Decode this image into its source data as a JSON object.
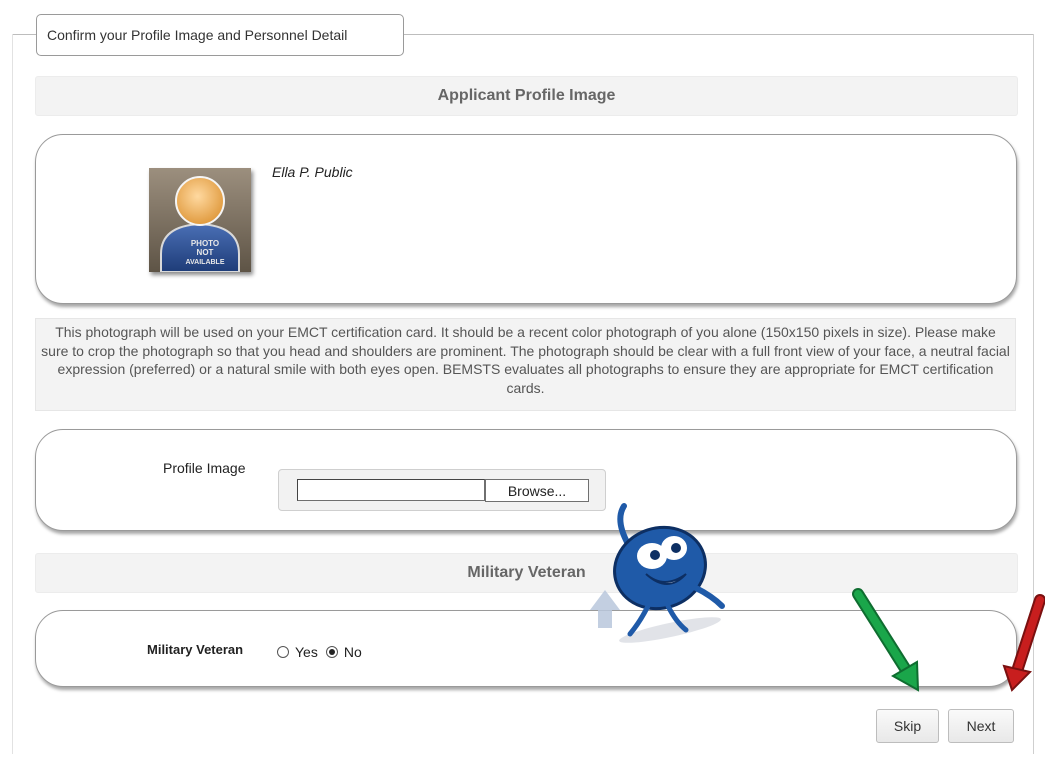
{
  "legend": "Confirm your Profile Image and Personnel Detail",
  "profile_section": {
    "title": "Applicant Profile Image",
    "name": "Ella P. Public",
    "avatar_text": [
      "PHOTO",
      "NOT",
      "AVAILABLE"
    ]
  },
  "note": "This photograph will be used on your EMCT certification card. It should be a recent color photograph of you alone (150x150 pixels in size). Please make sure to crop the photograph so that you head and shoulders are prominent. The photograph should be clear with a full front view of your face, a neutral facial expression (preferred) or a natural smile with both eyes open. BEMSTS evaluates all photographs to ensure they are appropriate for EMCT certification cards.",
  "upload": {
    "label": "Profile Image",
    "value": "",
    "browse_label": "Browse..."
  },
  "military_section": {
    "title": "Military Veteran",
    "label": "Military Veteran",
    "options": [
      "Yes",
      "No"
    ],
    "selected": "No"
  },
  "buttons": {
    "skip": "Skip",
    "next": "Next"
  },
  "colors": {
    "green_arrow": "#1aa64a",
    "red_arrow": "#c81e1e",
    "mascot_blue": "#1f5aa8"
  }
}
